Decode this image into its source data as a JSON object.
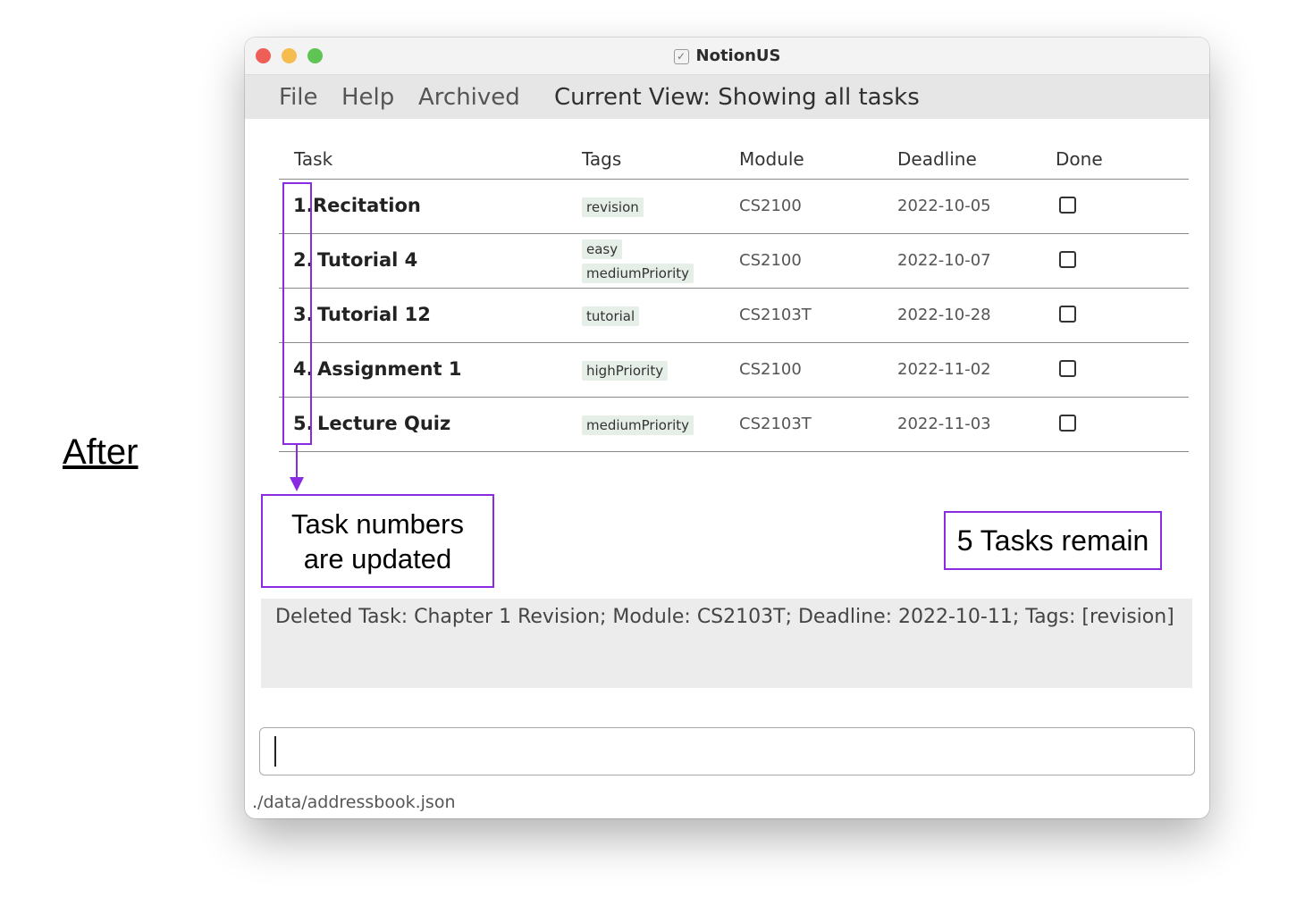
{
  "annotation": {
    "after_label": "After",
    "callout_left_line1": "Task numbers",
    "callout_left_line2": "are updated",
    "callout_right": "5 Tasks remain",
    "highlight_color": "#8a2be2"
  },
  "window": {
    "title": "NotionUS",
    "title_icon": "checkbox-icon"
  },
  "menu": {
    "file": "File",
    "help": "Help",
    "archived": "Archived",
    "current_view": "Current View: Showing all tasks"
  },
  "table": {
    "headers": {
      "task": "Task",
      "tags": "Tags",
      "module": "Module",
      "deadline": "Deadline",
      "done": "Done"
    },
    "rows": [
      {
        "num": "1.",
        "name": "Recitation",
        "tags": [
          "revision"
        ],
        "module": "CS2100",
        "deadline": "2022-10-05",
        "done": false
      },
      {
        "num": "2.",
        "name": "Tutorial 4",
        "tags": [
          "easy",
          "mediumPriority"
        ],
        "module": "CS2100",
        "deadline": "2022-10-07",
        "done": false
      },
      {
        "num": "3.",
        "name": "Tutorial 12",
        "tags": [
          "tutorial"
        ],
        "module": "CS2103T",
        "deadline": "2022-10-28",
        "done": false
      },
      {
        "num": "4.",
        "name": "Assignment 1",
        "tags": [
          "highPriority"
        ],
        "module": "CS2100",
        "deadline": "2022-11-02",
        "done": false
      },
      {
        "num": "5.",
        "name": "Lecture Quiz",
        "tags": [
          "mediumPriority"
        ],
        "module": "CS2103T",
        "deadline": "2022-11-03",
        "done": false
      }
    ]
  },
  "result": {
    "message": "Deleted Task: Chapter 1 Revision; Module: CS2103T; Deadline: 2022-10-11; Tags: [revision]"
  },
  "command": {
    "value": ""
  },
  "status": {
    "path": "./data/addressbook.json"
  }
}
